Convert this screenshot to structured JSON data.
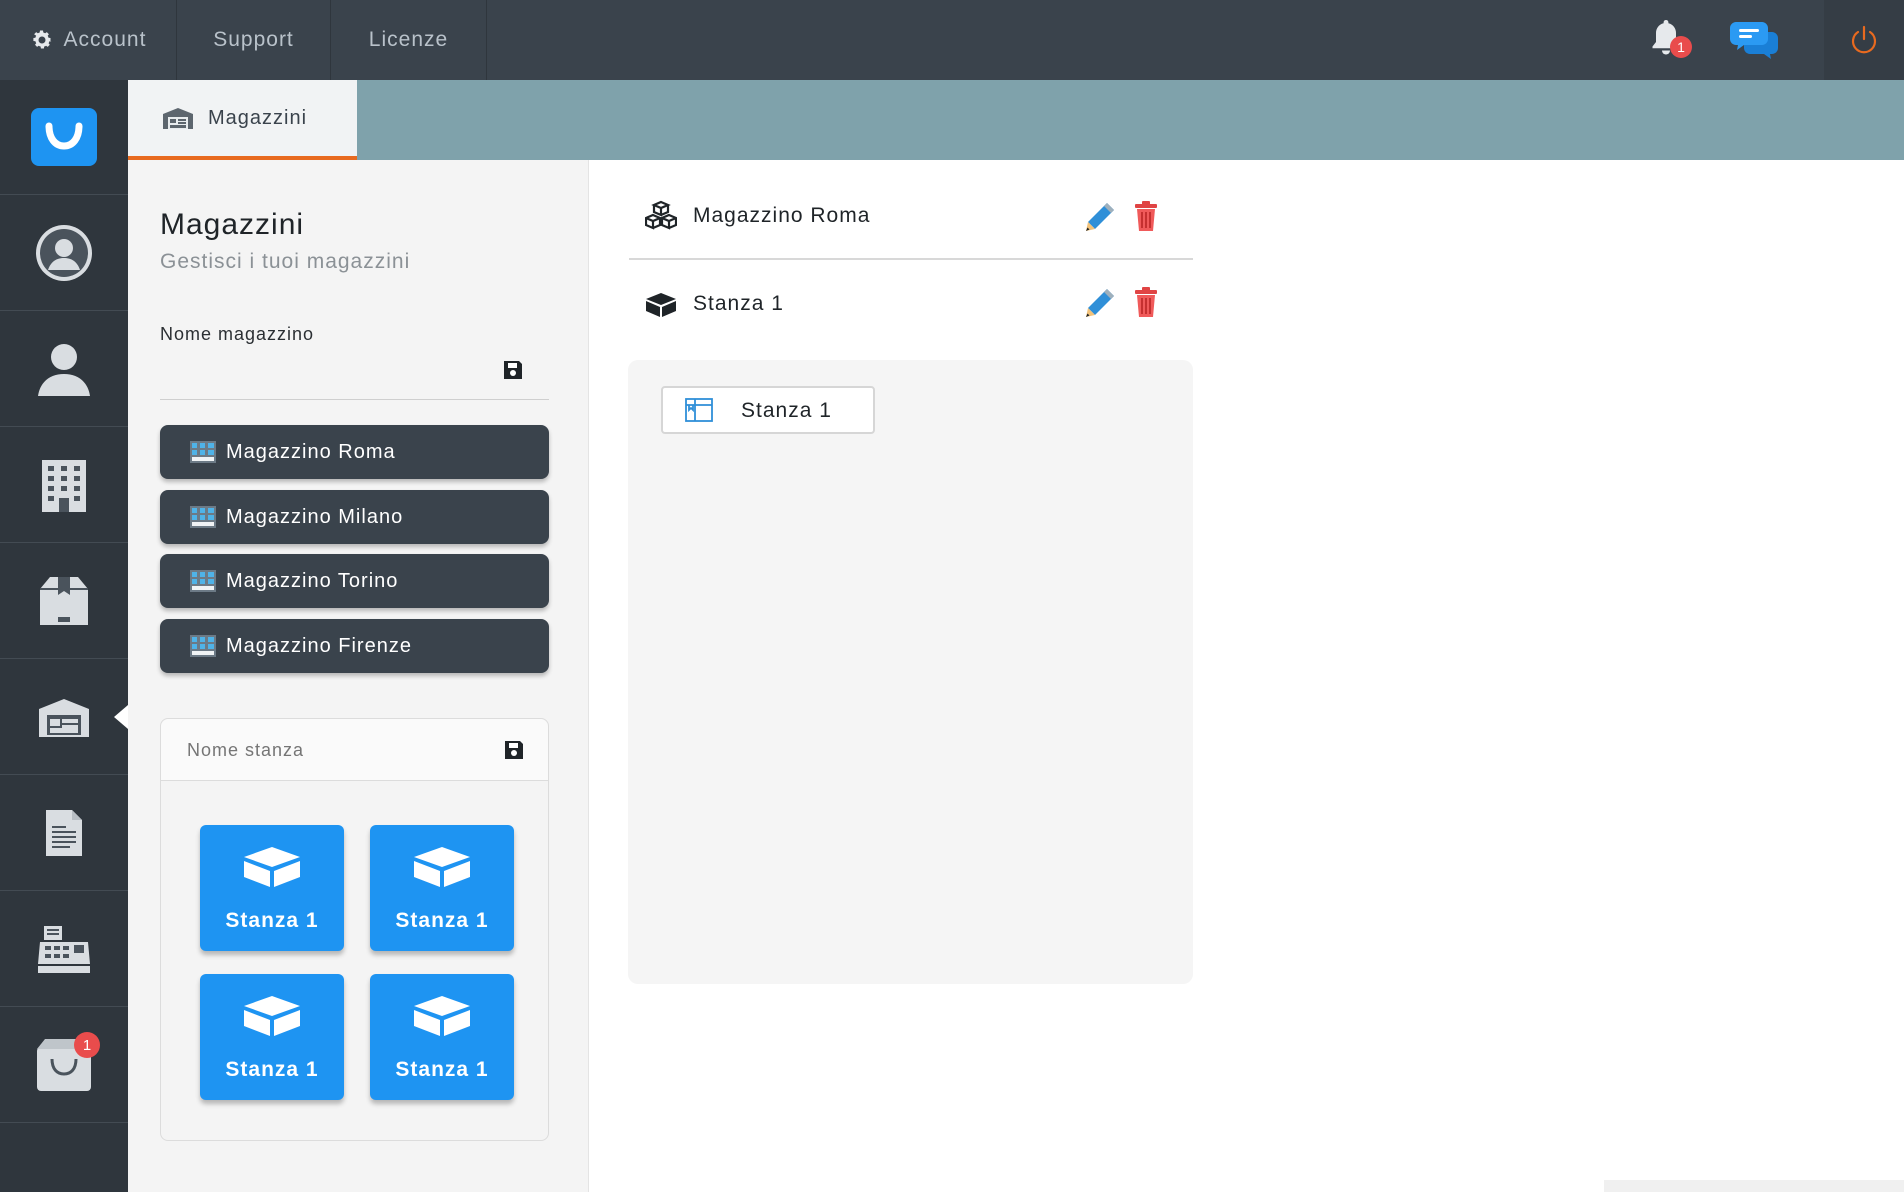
{
  "topnav": {
    "account_label": "Account",
    "support_label": "Support",
    "licenze_label": "Licenze",
    "notification_count": "1"
  },
  "sidebar": {
    "cart_badge": "1"
  },
  "tab": {
    "label": "Magazzini"
  },
  "leftpanel": {
    "title": "Magazzini",
    "subtitle": "Gestisci i tuoi magazzini",
    "warehouse_field_label": "Nome magazzino",
    "warehouse_field_value": "",
    "warehouses": [
      "Magazzino Roma",
      "Magazzino Milano",
      "Magazzino Torino",
      "Magazzino Firenze"
    ],
    "room_field_placeholder": "Nome stanza",
    "rooms": [
      "Stanza 1",
      "Stanza 1",
      "Stanza 1",
      "Stanza 1"
    ]
  },
  "main": {
    "selected_warehouse": "Magazzino Roma",
    "selected_room": "Stanza 1",
    "room_chip_label": "Stanza 1"
  },
  "colors": {
    "topbar": "#3a434c",
    "sidebar": "#2f363d",
    "tabstrip": "#7fa2ab",
    "accent_orange": "#e86a1f",
    "tile_blue": "#1e94f2",
    "badge_red": "#e94c4c"
  }
}
